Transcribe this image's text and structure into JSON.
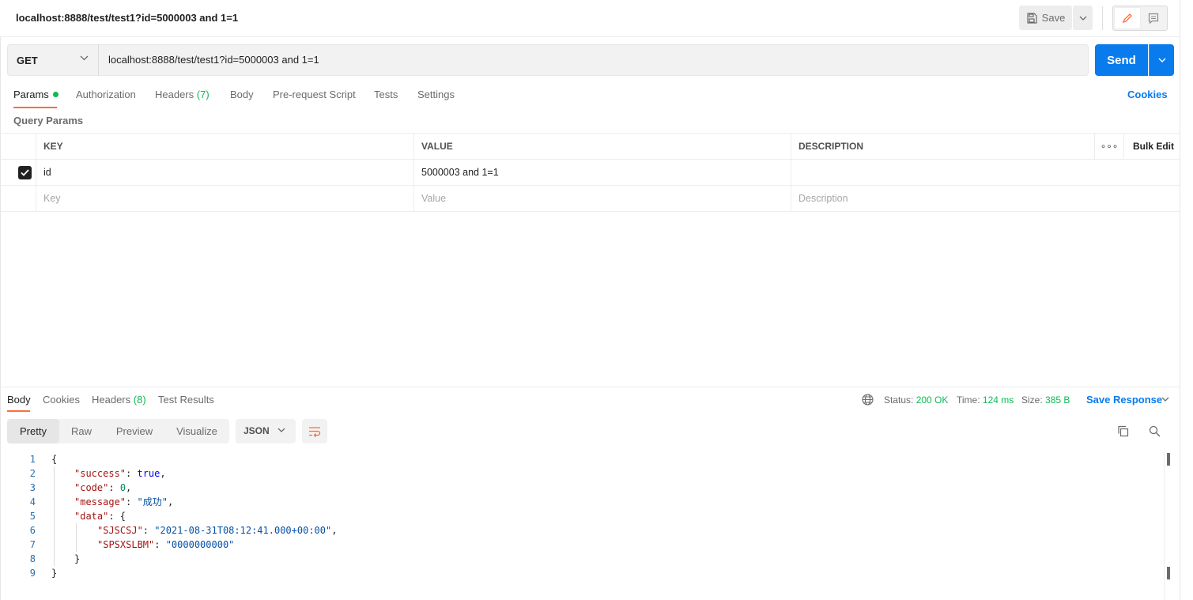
{
  "request": {
    "title": "localhost:8888/test/test1?id=5000003 and 1=1",
    "method": "GET",
    "url": "localhost:8888/test/test1?id=5000003 and 1=1",
    "save_label": "Save",
    "send_label": "Send"
  },
  "tabs": {
    "params": "Params",
    "authorization": "Authorization",
    "headers": "Headers",
    "headers_count": "(7)",
    "body": "Body",
    "prerequest": "Pre-request Script",
    "tests": "Tests",
    "settings": "Settings",
    "cookies": "Cookies"
  },
  "params": {
    "section_title": "Query Params",
    "columns": {
      "key": "KEY",
      "value": "VALUE",
      "description": "DESCRIPTION",
      "more": "∘∘∘",
      "bulk_edit": "Bulk Edit"
    },
    "rows": [
      {
        "key": "id",
        "value": "5000003 and 1=1",
        "description": "",
        "checked": true
      }
    ],
    "placeholders": {
      "key": "Key",
      "value": "Value",
      "description": "Description"
    }
  },
  "response": {
    "tabs": {
      "body": "Body",
      "cookies": "Cookies",
      "headers": "Headers",
      "headers_count": "(8)",
      "test_results": "Test Results"
    },
    "status_label": "Status:",
    "status_value": "200 OK",
    "time_label": "Time:",
    "time_value": "124 ms",
    "size_label": "Size:",
    "size_value": "385 B",
    "save_response": "Save Response",
    "views": {
      "pretty": "Pretty",
      "raw": "Raw",
      "preview": "Preview",
      "visualize": "Visualize"
    },
    "format": "JSON",
    "code": {
      "line_numbers": [
        "1",
        "2",
        "3",
        "4",
        "5",
        "6",
        "7",
        "8",
        "9"
      ],
      "open_brace": "{",
      "success_key": "\"success\"",
      "success_val": "true",
      "code_key": "\"code\"",
      "code_val": "0",
      "message_key": "\"message\"",
      "message_val": "\"成功\"",
      "data_key": "\"data\"",
      "sjscsj_key": "\"SJSCSJ\"",
      "sjscsj_val": "\"2021-08-31T08:12:41.000+00:00\"",
      "spsxslbm_key": "\"SPSXSLBM\"",
      "spsxslbm_val": "\"0000000000\"",
      "inner_close": "}",
      "close_brace": "}"
    }
  },
  "colors": {
    "accent": "#ff6c37",
    "primary": "#097bed",
    "success": "#0cbb52"
  }
}
